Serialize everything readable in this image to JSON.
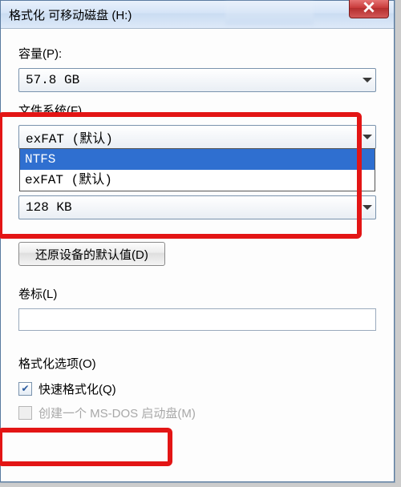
{
  "title": "格式化 可移动磁盘 (H:)",
  "capacity": {
    "label": "容量(P):",
    "value": "57.8 GB"
  },
  "file_system": {
    "label": "文件系统(F)",
    "value": "exFAT (默认)",
    "options": [
      "NTFS",
      "exFAT (默认)"
    ],
    "highlighted_index": 0
  },
  "allocation_unit": {
    "value": "128 KB"
  },
  "restore_defaults": "还原设备的默认值(D)",
  "volume_label": {
    "label": "卷标(L)",
    "value": ""
  },
  "format_options": {
    "label": "格式化选项(O)",
    "quick_format": {
      "label": "快速格式化(Q)",
      "checked": true
    },
    "create_dos": {
      "label": "创建一个 MS-DOS 启动盘(M)",
      "checked": false,
      "disabled": true
    }
  }
}
